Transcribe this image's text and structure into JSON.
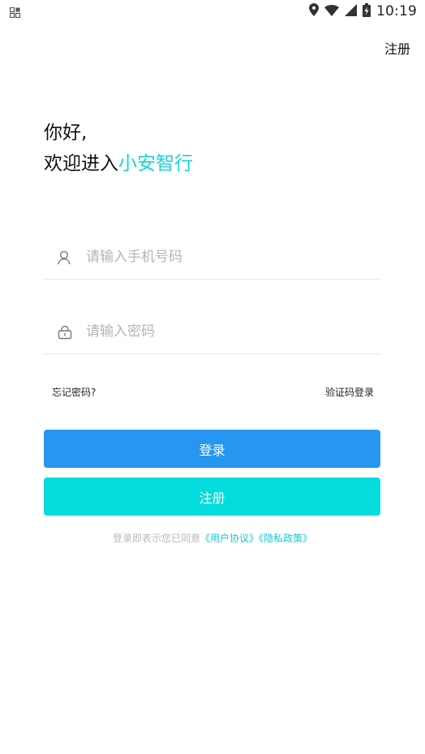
{
  "status_bar": {
    "time": "10:19",
    "icons": [
      "app-grid-icon",
      "location-icon",
      "wifi-icon",
      "signal-icon",
      "battery-icon"
    ]
  },
  "header": {
    "register_label": "注册"
  },
  "greeting": {
    "line1": "你好,",
    "line2_prefix": "欢迎进入",
    "brand": "小安智行"
  },
  "form": {
    "phone": {
      "placeholder": "请输入手机号码",
      "value": ""
    },
    "password": {
      "placeholder": "请输入密码",
      "value": ""
    },
    "forgot_label": "忘记密码?",
    "code_login_label": "验证码登录",
    "login_button": "登录",
    "register_button": "注册"
  },
  "agreement": {
    "prefix": "登录即表示您已同意",
    "user_agreement": "《用户协议》",
    "privacy_policy": "《隐私政策》"
  },
  "colors": {
    "brand_text": "#17d0d8",
    "login_button": "#2796f0",
    "register_button": "#05dcdc",
    "link": "#17c6d0"
  }
}
